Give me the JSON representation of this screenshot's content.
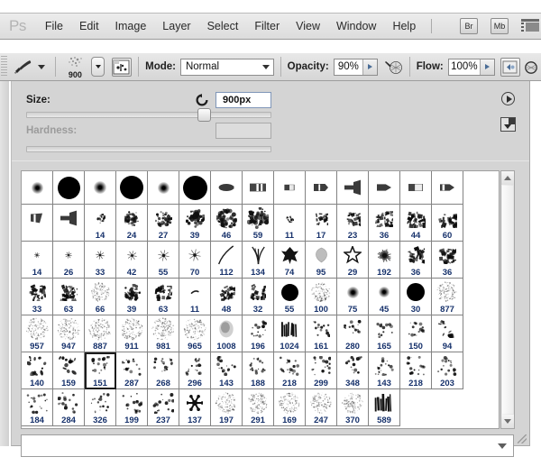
{
  "app": {
    "logo": "Ps"
  },
  "menubar": {
    "items": [
      "File",
      "Edit",
      "Image",
      "Layer",
      "Select",
      "Filter",
      "View",
      "Window",
      "Help"
    ],
    "right_buttons": [
      {
        "label": "Br",
        "name": "bridge-button"
      },
      {
        "label": "Mb",
        "name": "mini-bridge-button"
      }
    ],
    "filmstrip_icon": "filmstrip-icon"
  },
  "options_bar": {
    "tool_icon": "brush-tool-icon",
    "preset_size": "900",
    "toggle_brush_panel_icon": "toggle-brush-panel-icon",
    "mode_label": "Mode:",
    "mode_value": "Normal",
    "opacity_label": "Opacity:",
    "opacity_value": "90%",
    "airbrush_icon": "airbrush-icon",
    "flow_label": "Flow:",
    "flow_value": "100%",
    "tablet_pressure_icon": "tablet-pressure-icon"
  },
  "brush_panel": {
    "size_label": "Size:",
    "size_value": "900px",
    "reset_icon": "reset-icon",
    "size_slider_percent": 73,
    "hardness_label": "Hardness:",
    "hardness_value": "",
    "menu_icon": "panel-menu-icon",
    "new_preset_icon": "new-brush-preset-icon",
    "scrollbar": {
      "up_icon": "scroll-up-arrow-icon",
      "down_icon": "scroll-down-arrow-icon"
    },
    "bottom_dropdown_value": "",
    "bottom_dropdown_icon": "chevron-down-icon",
    "resize_grip": "resize-grip",
    "selected_brush": "151",
    "rows": [
      [
        {
          "num": "",
          "kind": "soft",
          "size": 13
        },
        {
          "num": "",
          "kind": "hard",
          "size": 25
        },
        {
          "num": "",
          "kind": "soft",
          "size": 14
        },
        {
          "num": "",
          "kind": "hard",
          "size": 26
        },
        {
          "num": "",
          "kind": "soft",
          "size": 13
        },
        {
          "num": "",
          "kind": "hard",
          "size": 27
        },
        {
          "num": "",
          "kind": "flat1",
          "size": 20
        },
        {
          "num": "",
          "kind": "flat2",
          "size": 20
        },
        {
          "num": "",
          "kind": "flat3",
          "size": 16
        },
        {
          "num": "",
          "kind": "flat4",
          "size": 18
        },
        {
          "num": "",
          "kind": "flat5",
          "size": 20
        },
        {
          "num": "",
          "kind": "flat6",
          "size": 18
        },
        {
          "num": "",
          "kind": "flat7",
          "size": 18
        },
        {
          "num": "",
          "kind": "flat8",
          "size": 18
        }
      ],
      [
        {
          "num": "",
          "kind": "flat9",
          "size": 18
        },
        {
          "num": "",
          "kind": "flat5",
          "size": 20
        },
        {
          "num": "14",
          "kind": "spatter",
          "size": 11
        },
        {
          "num": "24",
          "kind": "spatter",
          "size": 17
        },
        {
          "num": "27",
          "kind": "spatter",
          "size": 19
        },
        {
          "num": "39",
          "kind": "spatter",
          "size": 21
        },
        {
          "num": "46",
          "kind": "spatter",
          "size": 23
        },
        {
          "num": "59",
          "kind": "spatter",
          "size": 24
        },
        {
          "num": "11",
          "kind": "chalk",
          "size": 9
        },
        {
          "num": "17",
          "kind": "chalk",
          "size": 15
        },
        {
          "num": "23",
          "kind": "chalk",
          "size": 17
        },
        {
          "num": "36",
          "kind": "chalk",
          "size": 20
        },
        {
          "num": "44",
          "kind": "chalk",
          "size": 21
        },
        {
          "num": "60",
          "kind": "chalk",
          "size": 22
        }
      ],
      [
        {
          "num": "14",
          "kind": "star",
          "size": 6
        },
        {
          "num": "26",
          "kind": "star",
          "size": 8
        },
        {
          "num": "33",
          "kind": "star",
          "size": 10
        },
        {
          "num": "42",
          "kind": "star",
          "size": 11
        },
        {
          "num": "55",
          "kind": "star",
          "size": 13
        },
        {
          "num": "70",
          "kind": "star",
          "size": 14
        },
        {
          "num": "112",
          "kind": "arc",
          "size": 22
        },
        {
          "num": "134",
          "kind": "grass",
          "size": 21
        },
        {
          "num": "74",
          "kind": "leaf",
          "size": 21
        },
        {
          "num": "95",
          "kind": "blob",
          "size": 19
        },
        {
          "num": "29",
          "kind": "starout",
          "size": 20
        },
        {
          "num": "192",
          "kind": "burst",
          "size": 17
        },
        {
          "num": "36",
          "kind": "chalk",
          "size": 20
        },
        {
          "num": "36",
          "kind": "chalk",
          "size": 20
        }
      ],
      [
        {
          "num": "33",
          "kind": "chalk",
          "size": 19
        },
        {
          "num": "63",
          "kind": "chalk",
          "size": 20
        },
        {
          "num": "66",
          "kind": "grain",
          "size": 22
        },
        {
          "num": "39",
          "kind": "spatter",
          "size": 19
        },
        {
          "num": "63",
          "kind": "chalk",
          "size": 20
        },
        {
          "num": "11",
          "kind": "dash",
          "size": 10
        },
        {
          "num": "48",
          "kind": "chalk",
          "size": 19
        },
        {
          "num": "32",
          "kind": "chalk",
          "size": 18
        },
        {
          "num": "55",
          "kind": "hard",
          "size": 19
        },
        {
          "num": "100",
          "kind": "grain",
          "size": 22
        },
        {
          "num": "75",
          "kind": "soft",
          "size": 13
        },
        {
          "num": "45",
          "kind": "soft",
          "size": 12
        },
        {
          "num": "30",
          "kind": "hard",
          "size": 20
        },
        {
          "num": "877",
          "kind": "grain",
          "size": 24
        }
      ],
      [
        {
          "num": "957",
          "kind": "grain",
          "size": 26
        },
        {
          "num": "947",
          "kind": "grain",
          "size": 26
        },
        {
          "num": "887",
          "kind": "grain",
          "size": 26
        },
        {
          "num": "911",
          "kind": "grain",
          "size": 26
        },
        {
          "num": "981",
          "kind": "grain",
          "size": 26
        },
        {
          "num": "965",
          "kind": "grain",
          "size": 26
        },
        {
          "num": "1008",
          "kind": "smudge",
          "size": 22
        },
        {
          "num": "196",
          "kind": "dots",
          "size": 22
        },
        {
          "num": "1024",
          "kind": "strokes",
          "size": 20
        },
        {
          "num": "161",
          "kind": "dots",
          "size": 20
        },
        {
          "num": "280",
          "kind": "dots",
          "size": 20
        },
        {
          "num": "165",
          "kind": "dots",
          "size": 20
        },
        {
          "num": "150",
          "kind": "dots",
          "size": 20
        },
        {
          "num": "94",
          "kind": "blobs",
          "size": 20
        }
      ],
      [
        {
          "num": "140",
          "kind": "blobs",
          "size": 22
        },
        {
          "num": "159",
          "kind": "blobs",
          "size": 22
        },
        {
          "num": "151",
          "kind": "dots",
          "size": 22
        },
        {
          "num": "287",
          "kind": "dots",
          "size": 22
        },
        {
          "num": "268",
          "kind": "dots",
          "size": 22
        },
        {
          "num": "296",
          "kind": "dots",
          "size": 22
        },
        {
          "num": "143",
          "kind": "dots",
          "size": 22
        },
        {
          "num": "188",
          "kind": "dots",
          "size": 22
        },
        {
          "num": "218",
          "kind": "dots",
          "size": 22
        },
        {
          "num": "299",
          "kind": "dots",
          "size": 22
        },
        {
          "num": "348",
          "kind": "dots",
          "size": 22
        },
        {
          "num": "143",
          "kind": "dots",
          "size": 22
        },
        {
          "num": "218",
          "kind": "dots",
          "size": 22
        },
        {
          "num": "203",
          "kind": "dots",
          "size": 22
        }
      ],
      [
        {
          "num": "184",
          "kind": "dots",
          "size": 24
        },
        {
          "num": "284",
          "kind": "dots",
          "size": 24
        },
        {
          "num": "326",
          "kind": "dots",
          "size": 24
        },
        {
          "num": "199",
          "kind": "dots",
          "size": 24
        },
        {
          "num": "237",
          "kind": "dots",
          "size": 24
        },
        {
          "num": "137",
          "kind": "snowflake",
          "size": 18
        },
        {
          "num": "197",
          "kind": "grain",
          "size": 24
        },
        {
          "num": "291",
          "kind": "grain",
          "size": 24
        },
        {
          "num": "169",
          "kind": "grain",
          "size": 24
        },
        {
          "num": "247",
          "kind": "grain",
          "size": 24
        },
        {
          "num": "370",
          "kind": "grain",
          "size": 24
        },
        {
          "num": "589",
          "kind": "strokes",
          "size": 22
        }
      ]
    ]
  },
  "colors": {
    "chrome": "#d4d4d4",
    "menubar_top": "#ececec",
    "grid_bg": "#ffffff",
    "number": "#16316b",
    "selection_border": "#1d1d1d"
  }
}
